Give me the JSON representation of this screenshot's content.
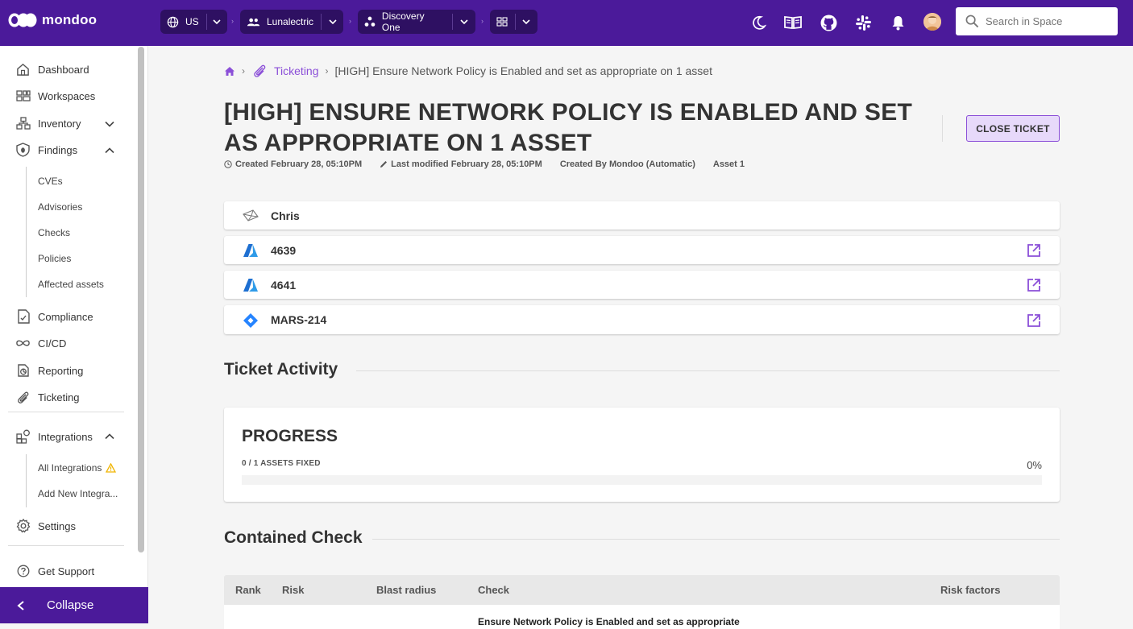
{
  "brand": {
    "name": "mondoo"
  },
  "topbar": {
    "region": "US",
    "organization": "Lunalectric",
    "space": "Discovery One",
    "search_placeholder": "Search in Space"
  },
  "sidebar": {
    "items": [
      {
        "label": "Dashboard"
      },
      {
        "label": "Workspaces"
      },
      {
        "label": "Inventory"
      },
      {
        "label": "Findings"
      },
      {
        "label": "Compliance"
      },
      {
        "label": "CI/CD"
      },
      {
        "label": "Reporting"
      },
      {
        "label": "Ticketing"
      },
      {
        "label": "Integrations"
      },
      {
        "label": "Settings"
      },
      {
        "label": "Get Support"
      }
    ],
    "findings_sub": [
      "CVEs",
      "Advisories",
      "Checks",
      "Policies",
      "Affected assets"
    ],
    "integrations_sub": [
      "All Integrations",
      "Add New Integra..."
    ],
    "collapse_label": "Collapse"
  },
  "breadcrumb": {
    "section": "Ticketing",
    "current": "[HIGH] Ensure Network Policy is Enabled and set as appropriate on 1 asset"
  },
  "ticket": {
    "title": "[HIGH] Ensure Network Policy is Enabled and set as appropriate on 1 asset",
    "close_label": "CLOSE TICKET",
    "created": "Created February 28, 05:10PM",
    "modified": "Last modified February 28, 05:10PM",
    "created_by": "Created By Mondoo (Automatic)",
    "asset_count": "Asset 1",
    "links": [
      {
        "label": "Chris",
        "icon": "email-icon"
      },
      {
        "label": "4639",
        "icon": "azure-icon"
      },
      {
        "label": "4641",
        "icon": "azure-icon"
      },
      {
        "label": "MARS-214",
        "icon": "jira-icon"
      }
    ]
  },
  "activity": {
    "title": "Ticket Activity",
    "progress_title": "PROGRESS",
    "progress_sub": "0 / 1 ASSETS FIXED",
    "progress_pct": "0%",
    "progress_value": 0
  },
  "contained": {
    "title": "Contained Check",
    "columns": [
      "Rank",
      "Risk",
      "Blast radius",
      "Check",
      "Risk factors"
    ],
    "first_check": "Ensure Network Policy is Enabled and set as appropriate"
  },
  "colors": {
    "brand": "#4b1a9a",
    "accent": "#8b4fd8",
    "warning": "#f0b400"
  }
}
